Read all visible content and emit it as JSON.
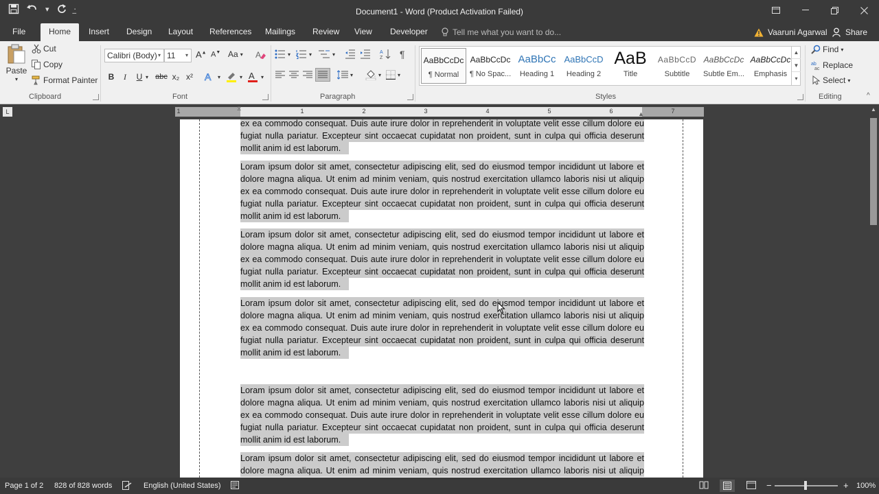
{
  "window": {
    "title": "Document1 - Word (Product Activation Failed)"
  },
  "tabs": [
    "File",
    "Home",
    "Insert",
    "Design",
    "Layout",
    "References",
    "Mailings",
    "Review",
    "View",
    "Developer"
  ],
  "tell_me": "Tell me what you want to do...",
  "user": "Vaaruni Agarwal",
  "share": "Share",
  "clipboard": {
    "paste": "Paste",
    "cut": "Cut",
    "copy": "Copy",
    "format_painter": "Format Painter",
    "label": "Clipboard"
  },
  "font": {
    "name": "Calibri (Body)",
    "size": "11",
    "label": "Font",
    "bold": "B",
    "italic": "I",
    "underline": "U",
    "strike": "abc",
    "sub": "x₂",
    "sup": "x²",
    "case": "Aa"
  },
  "paragraph": {
    "label": "Paragraph"
  },
  "styles": {
    "label": "Styles",
    "items": [
      {
        "preview": "AaBbCcDc",
        "name": "¶ Normal"
      },
      {
        "preview": "AaBbCcDc",
        "name": "¶ No Spac..."
      },
      {
        "preview": "AaBbCc",
        "name": "Heading 1"
      },
      {
        "preview": "AaBbCcD",
        "name": "Heading 2"
      },
      {
        "preview": "AaB",
        "name": "Title"
      },
      {
        "preview": "AaBbCcD",
        "name": "Subtitle"
      },
      {
        "preview": "AaBbCcDc",
        "name": "Subtle Em..."
      },
      {
        "preview": "AaBbCcDc",
        "name": "Emphasis"
      }
    ]
  },
  "editing": {
    "label": "Editing",
    "find": "Find",
    "replace": "Replace",
    "select": "Select"
  },
  "ruler": {
    "numbers": [
      "1",
      "1",
      "2",
      "3",
      "4",
      "5",
      "6",
      "7"
    ]
  },
  "document": {
    "first_partial": [
      "ex ea commodo consequat. Duis aute irure dolor in reprehenderit in voluptate velit esse cillum dolore eu",
      "fugiat nulla pariatur. Excepteur sint occaecat cupidatat non proident, sunt in culpa qui officia deserunt",
      "mollit anim id est laborum."
    ],
    "paragraph_lines": [
      "Loram ipsum dolor sit amet, consectetur adipiscing elit, sed do eiusmod tempor incididunt ut labore et",
      "dolore magna aliqua. Ut enim ad minim veniam, quis nostrud exercitation ullamco laboris nisi ut aliquip",
      "ex ea commodo consequat. Duis aute irure dolor in reprehenderit in voluptate velit esse cillum dolore eu",
      "fugiat nulla pariatur. Excepteur sint occaecat cupidatat non proident, sunt in culpa qui officia deserunt",
      "mollit anim id est laborum."
    ],
    "last_partial": [
      "Loram ipsum dolor sit amet, consectetur adipiscing elit, sed do eiusmod tempor incididunt ut labore et",
      "dolore magna aliqua. Ut enim ad minim veniam, quis nostrud exercitation ullamco laboris nisi ut aliquip"
    ]
  },
  "status": {
    "page": "Page 1 of 2",
    "words": "828 of 828 words",
    "language": "English (United States)",
    "zoom": "100%"
  }
}
